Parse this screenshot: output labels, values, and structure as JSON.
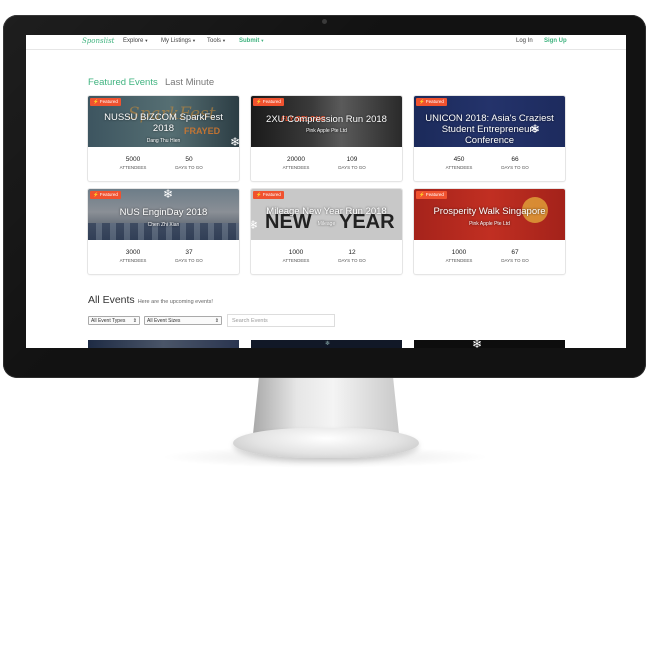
{
  "nav": {
    "logo": "Sponslist",
    "explore": "Explore",
    "my_listings": "My Listings",
    "tools": "Tools",
    "submit": "Submit",
    "login": "Log In",
    "signup": "Sign Up"
  },
  "tabs": {
    "featured": "Featured Events",
    "last_minute": "Last Minute"
  },
  "badge_label": "Featured",
  "stat_labels": {
    "attendees": "ATTENDEES",
    "days": "DAYS TO GO"
  },
  "cards": [
    {
      "title_line1": "NUSSU BIZCOM SparkFest",
      "title_line2": "2018",
      "organizer": "Dang Thu Hien",
      "attendees": "5000",
      "days": "50"
    },
    {
      "title_line1": "2XU Compression Run 2018",
      "title_line2": "",
      "organizer": "Pink Apple Pte Ltd",
      "attendees": "20000",
      "days": "109"
    },
    {
      "title_line1": "UNICON 2018: Asia's Craziest",
      "title_line2": "Student Entrepreneurs",
      "title_line3": "Conference",
      "organizer": "",
      "attendees": "450",
      "days": "66"
    },
    {
      "title_line1": "NUS EnginDay 2018",
      "title_line2": "",
      "organizer": "Chen Zhi Xian",
      "attendees": "3000",
      "days": "37"
    },
    {
      "title_line1": "Mileage New Year Run 2018",
      "title_line2": "",
      "organizer": "Mileage",
      "attendees": "1000",
      "days": "12"
    },
    {
      "title_line1": "Prosperity Walk Singapore",
      "title_line2": "",
      "organizer": "Pink Apple Pte Ltd",
      "attendees": "1000",
      "days": "67"
    }
  ],
  "all_events": {
    "title": "All Events",
    "subtitle": "Here are the upcoming events!",
    "filter_type": "All Event Types",
    "filter_size": "All Event Sizes",
    "search_placeholder": "Search Events"
  },
  "colors": {
    "accent": "#3fb37f",
    "badge": "#f0522f"
  },
  "icons": [
    "lightning-icon",
    "snowflake-icon",
    "caret-down-icon"
  ]
}
